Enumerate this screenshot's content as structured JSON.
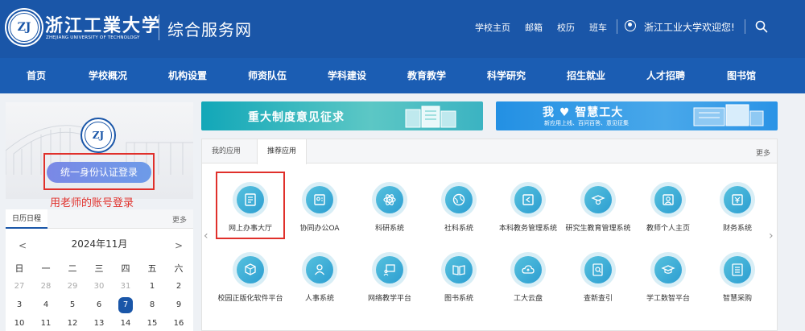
{
  "header": {
    "logo_cn": "浙江工業大学",
    "logo_en": "ZHEJIANG UNIVERSITY OF TECHNOLOGY",
    "site_name": "综合服务网",
    "links": [
      "学校主页",
      "邮箱",
      "校历",
      "班车"
    ],
    "welcome": "浙江工业大学欢迎您!"
  },
  "nav": [
    "首页",
    "学校概况",
    "机构设置",
    "师资队伍",
    "学科建设",
    "教育教学",
    "科学研究",
    "招生就业",
    "人才招聘",
    "图书馆"
  ],
  "login": {
    "button": "统一身份认证登录",
    "annotation": "用老师的账号登录"
  },
  "calendar": {
    "tab": "日历日程",
    "more": "更多",
    "month": "2024年11月",
    "prev": "<",
    "next": ">",
    "weekdays": [
      "日",
      "一",
      "二",
      "三",
      "四",
      "五",
      "六"
    ],
    "rows": [
      [
        "27",
        "28",
        "29",
        "30",
        "31",
        "1",
        "2"
      ],
      [
        "3",
        "4",
        "5",
        "6",
        "7",
        "8",
        "9"
      ],
      [
        "10",
        "11",
        "12",
        "13",
        "14",
        "15",
        "16"
      ]
    ],
    "today": "7"
  },
  "banners": {
    "left_title": "重大制度意见征求",
    "right_title_a": "我",
    "right_title_b": "智慧工大",
    "right_sub": "新应用上线、百问百答、意见征集"
  },
  "apps": {
    "tabs": [
      "我的应用",
      "推荐应用"
    ],
    "more": "更多",
    "row1": [
      "网上办事大厅",
      "协同办公OA",
      "科研系统",
      "社科系统",
      "本科教务管理系统",
      "研究生教育管理系统",
      "教师个人主页",
      "财务系统"
    ],
    "row2": [
      "校园正版化软件平台",
      "人事系统",
      "网络教学平台",
      "图书系统",
      "工大云盘",
      "查新查引",
      "学工数智平台",
      "智慧采购"
    ]
  },
  "colors": {
    "header_bg": "#1a56a8",
    "nav_bg": "#1b5db3",
    "highlight": "#e0302b",
    "icon_blue": "#2d9ed1"
  }
}
